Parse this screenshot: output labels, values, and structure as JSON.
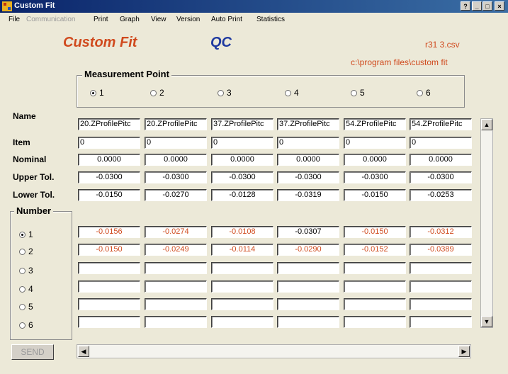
{
  "window": {
    "title": "Custom Fit",
    "help_label": "?",
    "minimize_label": "_",
    "maximize_label": "□",
    "close_label": "×"
  },
  "menu": [
    {
      "label": "File",
      "enabled": true
    },
    {
      "label": "Communication",
      "enabled": false
    },
    {
      "label": "Print",
      "enabled": true
    },
    {
      "label": "Graph",
      "enabled": true
    },
    {
      "label": "View",
      "enabled": true
    },
    {
      "label": "Version",
      "enabled": true
    },
    {
      "label": "Auto Print",
      "enabled": true
    },
    {
      "label": "Statistics",
      "enabled": true
    }
  ],
  "header": {
    "app_name": "Custom Fit",
    "mode": "QC",
    "filename": "r31  3.csv",
    "path": "c:\\program files\\custom fit"
  },
  "measurement_point": {
    "label": "Measurement Point",
    "options": [
      "1",
      "2",
      "3",
      "4",
      "5",
      "6"
    ],
    "selected": "1"
  },
  "row_labels": {
    "name": "Name",
    "item": "Item",
    "nominal": "Nominal",
    "upper_tol": "Upper Tol.",
    "lower_tol": "Lower Tol."
  },
  "columns": [
    {
      "name": "20.ZProfilePitc",
      "item": "0",
      "nominal": "0.0000",
      "upper_tol": "-0.0300",
      "lower_tol": "-0.0150"
    },
    {
      "name": "20.ZProfilePitc",
      "item": "0",
      "nominal": "0.0000",
      "upper_tol": "-0.0300",
      "lower_tol": "-0.0270"
    },
    {
      "name": "37.ZProfilePitc",
      "item": "0",
      "nominal": "0.0000",
      "upper_tol": "-0.0300",
      "lower_tol": "-0.0128"
    },
    {
      "name": "37.ZProfilePitc",
      "item": "0",
      "nominal": "0.0000",
      "upper_tol": "-0.0300",
      "lower_tol": "-0.0319"
    },
    {
      "name": "54.ZProfilePitc",
      "item": "0",
      "nominal": "0.0000",
      "upper_tol": "-0.0300",
      "lower_tol": "-0.0150"
    },
    {
      "name": "54.ZProfilePitc",
      "item": "0",
      "nominal": "0.0000",
      "upper_tol": "-0.0300",
      "lower_tol": "-0.0253"
    }
  ],
  "number": {
    "label": "Number",
    "options": [
      "1",
      "2",
      "3",
      "4",
      "5",
      "6"
    ],
    "selected": "1"
  },
  "readings": [
    [
      "-0.0156",
      "-0.0274",
      "-0.0108",
      "-0.0307",
      "-0.0150",
      "-0.0312"
    ],
    [
      "-0.0150",
      "-0.0249",
      "-0.0114",
      "-0.0290",
      "-0.0152",
      "-0.0389"
    ],
    [
      "",
      "",
      "",
      "",
      "",
      ""
    ],
    [
      "",
      "",
      "",
      "",
      "",
      ""
    ],
    [
      "",
      "",
      "",
      "",
      "",
      ""
    ],
    [
      "",
      "",
      "",
      "",
      "",
      ""
    ]
  ],
  "reading_out_of_tol": [
    [
      true,
      true,
      true,
      false,
      true,
      true
    ],
    [
      true,
      true,
      true,
      true,
      true,
      true
    ],
    [
      false,
      false,
      false,
      false,
      false,
      false
    ],
    [
      false,
      false,
      false,
      false,
      false,
      false
    ],
    [
      false,
      false,
      false,
      false,
      false,
      false
    ],
    [
      false,
      false,
      false,
      false,
      false,
      false
    ]
  ],
  "colors": {
    "accent_red": "#d04a1e",
    "qc_blue": "#1f3aa0"
  },
  "buttons": {
    "send_label": "SEND"
  },
  "scroll_icons": {
    "up": "▲",
    "down": "▼",
    "left": "◀",
    "right": "▶"
  }
}
